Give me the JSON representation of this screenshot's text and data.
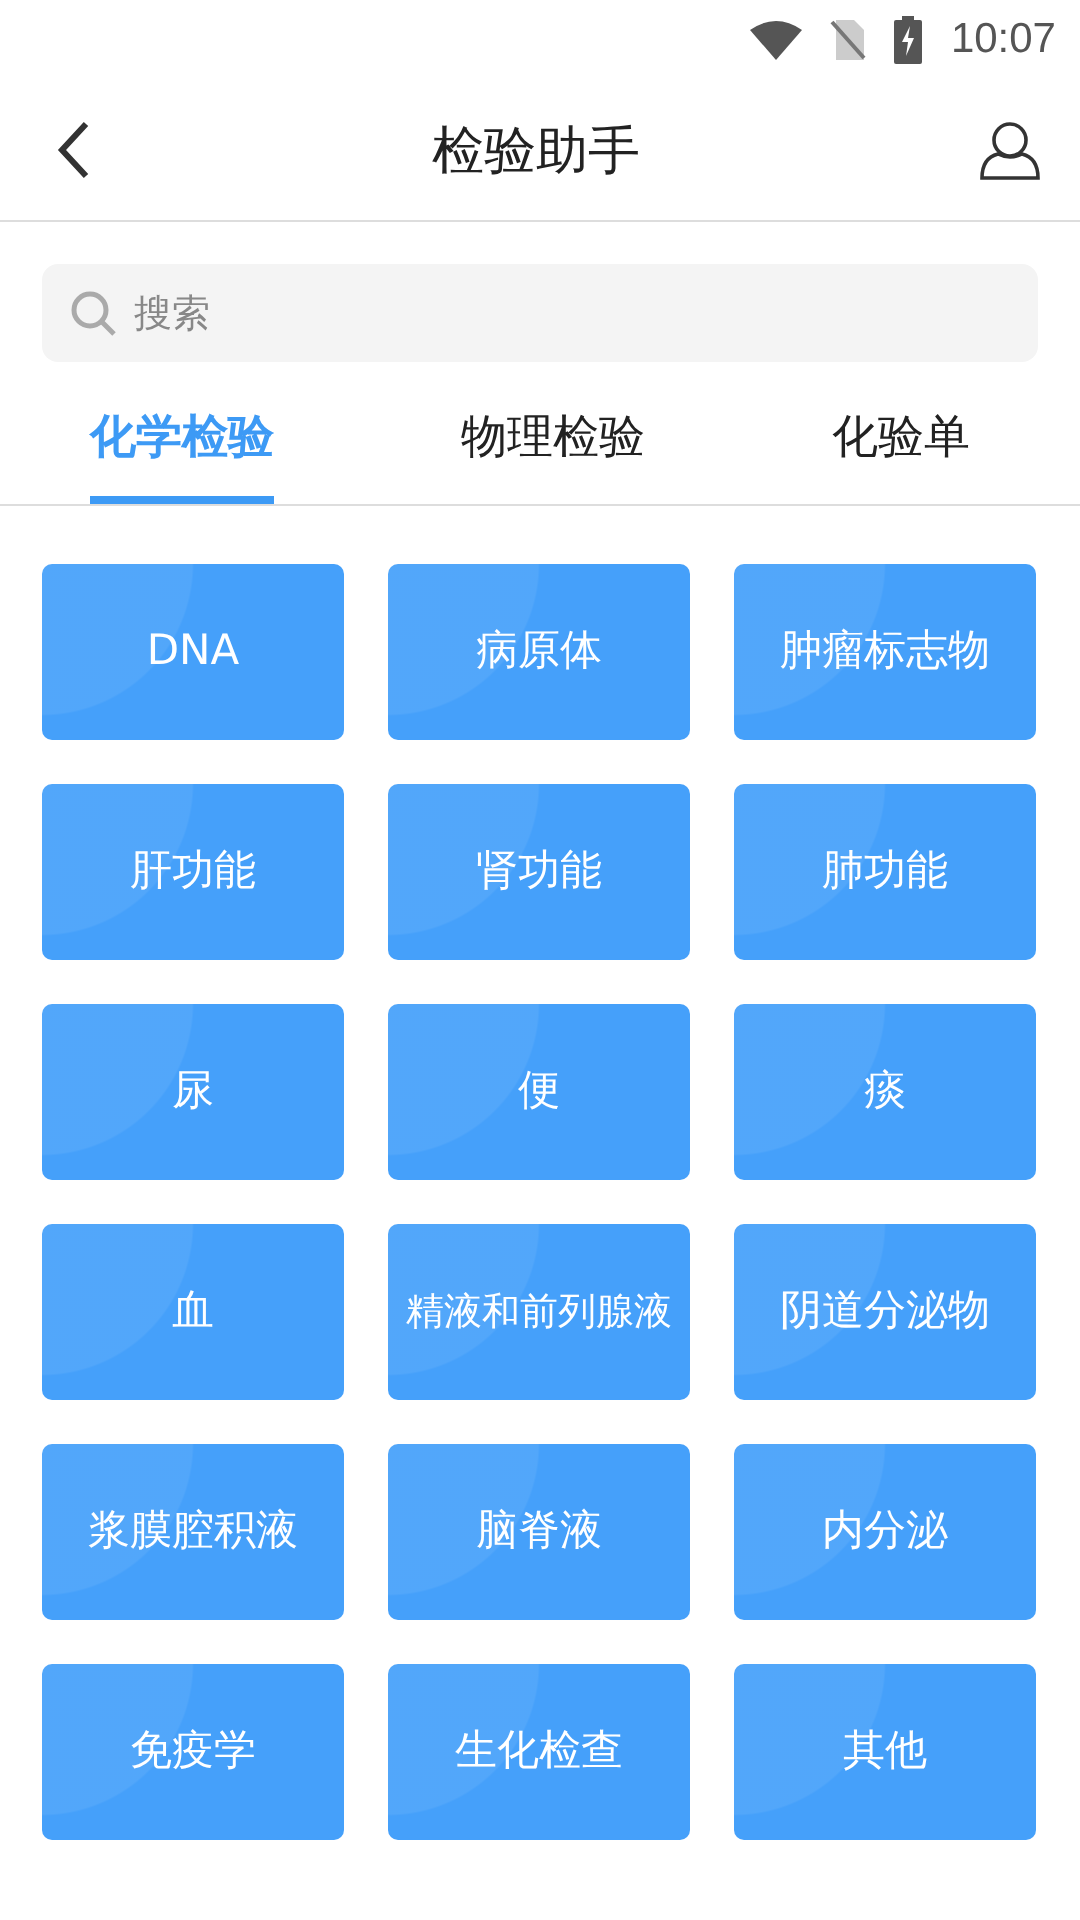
{
  "status_bar": {
    "time": "10:07"
  },
  "header": {
    "title": "检验助手"
  },
  "search": {
    "placeholder": "搜索"
  },
  "tabs": [
    {
      "label": "化学检验",
      "selected": true
    },
    {
      "label": "物理检验",
      "selected": false
    },
    {
      "label": "化验单",
      "selected": false
    }
  ],
  "tiles": [
    "DNA",
    "病原体",
    "肿瘤标志物",
    "肝功能",
    "肾功能",
    "肺功能",
    "尿",
    "便",
    "痰",
    "血",
    "精液和前列腺液",
    "阴道分泌物",
    "浆膜腔积液",
    "脑脊液",
    "内分泌",
    "免疫学",
    "生化检查",
    "其他"
  ]
}
